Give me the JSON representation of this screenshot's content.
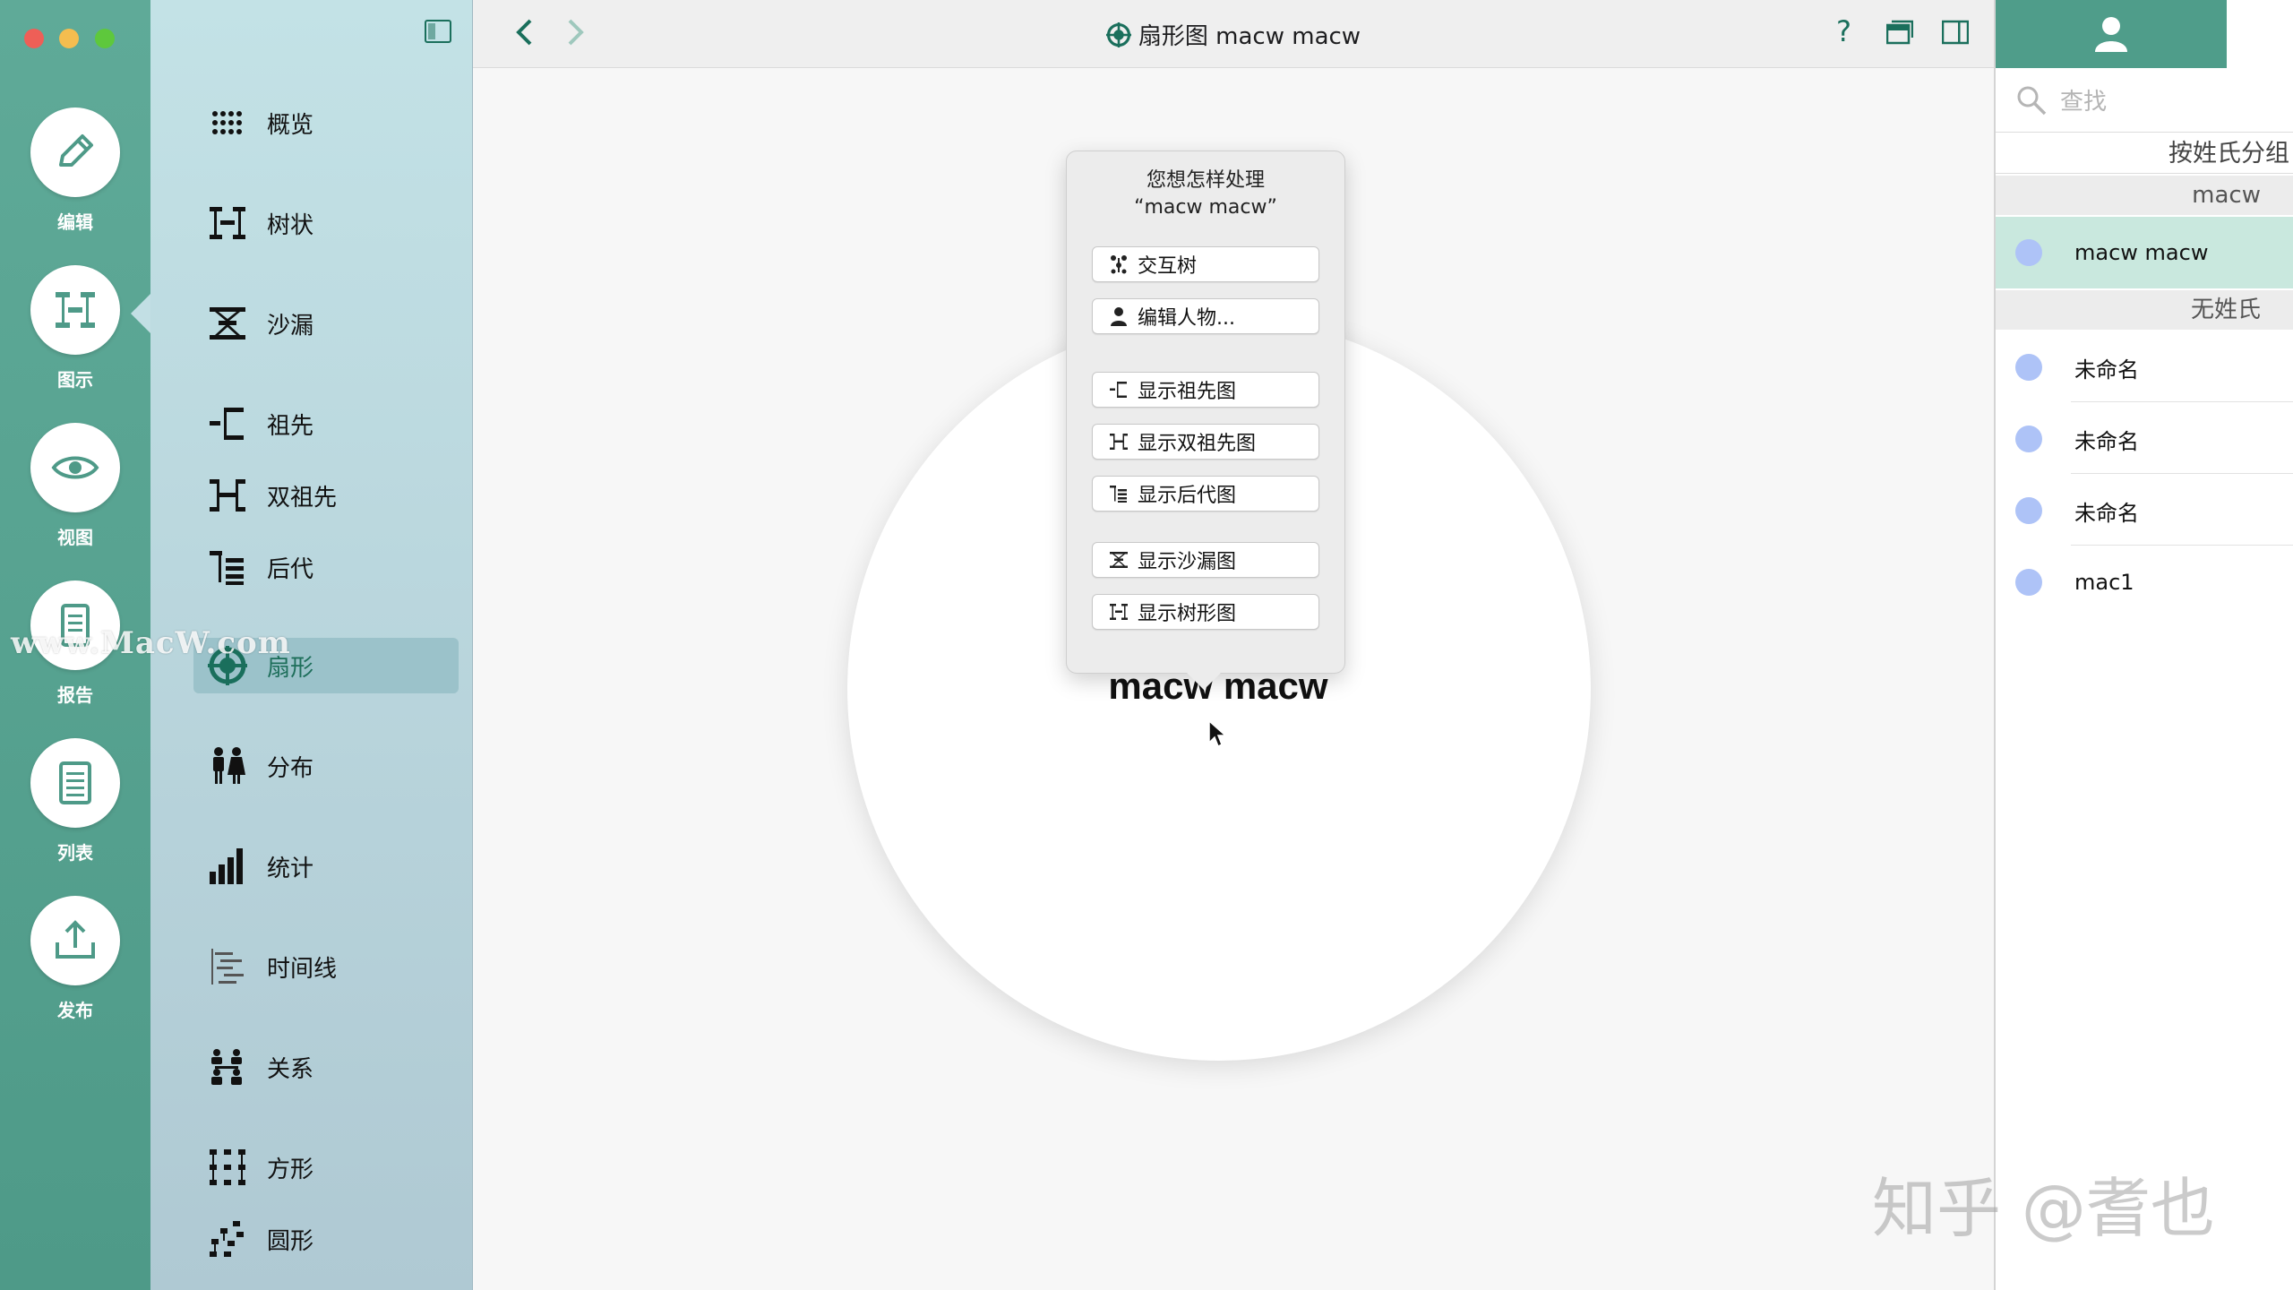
{
  "rail": {
    "items": [
      {
        "label": "编辑",
        "icon": "pencil-icon"
      },
      {
        "label": "图示",
        "icon": "chart-tree-icon"
      },
      {
        "label": "视图",
        "icon": "eye-icon"
      },
      {
        "label": "报告",
        "icon": "report-icon"
      },
      {
        "label": "列表",
        "icon": "list-icon"
      },
      {
        "label": "发布",
        "icon": "upload-icon"
      }
    ]
  },
  "nav": {
    "items": [
      {
        "label": "概览",
        "icon": "grid-icon"
      },
      {
        "label": "树状",
        "icon": "tree-icon"
      },
      {
        "label": "沙漏",
        "icon": "hourglass-icon"
      },
      {
        "label": "祖先",
        "icon": "ancestor-icon"
      },
      {
        "label": "双祖先",
        "icon": "double-ancestor-icon"
      },
      {
        "label": "后代",
        "icon": "descendant-icon"
      },
      {
        "label": "扇形",
        "icon": "fan-icon",
        "active": true
      },
      {
        "label": "分布",
        "icon": "distribution-icon"
      },
      {
        "label": "统计",
        "icon": "statistics-icon"
      },
      {
        "label": "时间线",
        "icon": "timeline-icon"
      },
      {
        "label": "关系",
        "icon": "relationship-icon"
      },
      {
        "label": "方形",
        "icon": "square-icon"
      },
      {
        "label": "圆形",
        "icon": "circle-icon"
      }
    ]
  },
  "toolbar": {
    "title": "扇形图 macw macw"
  },
  "canvas": {
    "person_name": "macw macw"
  },
  "popover": {
    "question_line1": "您想怎样处理",
    "question_line2": "“macw macw”",
    "buttons": [
      {
        "label": "交互树"
      },
      {
        "label": "编辑人物..."
      },
      {
        "label": "显示祖先图"
      },
      {
        "label": "显示双祖先图"
      },
      {
        "label": "显示后代图"
      },
      {
        "label": "显示沙漏图"
      },
      {
        "label": "显示树形图"
      }
    ]
  },
  "right": {
    "search_placeholder": "查找",
    "group_by": "按姓氏分组",
    "sections": [
      {
        "title": "macw",
        "people": [
          "macw macw"
        ]
      },
      {
        "title": "无姓氏",
        "people": [
          "未命名",
          "未命名",
          "未命名",
          "mac1"
        ]
      }
    ]
  },
  "watermarks": {
    "left": "www.MacW.com",
    "right": "知乎 @耆也"
  },
  "colors": {
    "accent": "#1a6f5c",
    "rail": "#55a08e",
    "selected_row": "#c9e8de",
    "person_dot": "#aec3f7"
  }
}
